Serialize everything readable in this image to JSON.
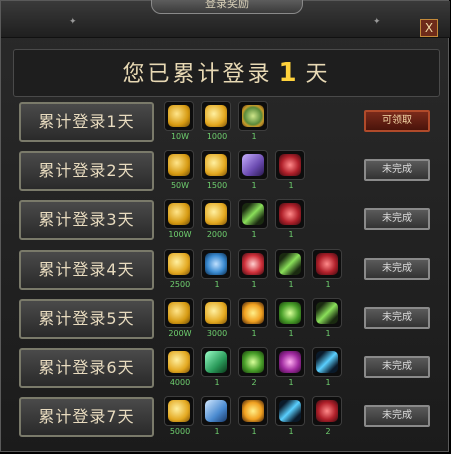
{
  "window": {
    "title": "登录奖励",
    "close_label": "X"
  },
  "header": {
    "prefix": "您已累计登录",
    "days": "1",
    "suffix": "天"
  },
  "rows": [
    {
      "label": "累计登录1天",
      "status": "可领取",
      "status_type": "claim",
      "items": [
        {
          "icon": "gold",
          "qty": "10W"
        },
        {
          "icon": "gold2",
          "qty": "1000"
        },
        {
          "icon": "egg",
          "qty": "1"
        }
      ]
    },
    {
      "label": "累计登录2天",
      "status": "未完成",
      "status_type": "todo",
      "items": [
        {
          "icon": "gold",
          "qty": "50W"
        },
        {
          "icon": "gold2",
          "qty": "1500"
        },
        {
          "icon": "wing",
          "qty": "1"
        },
        {
          "icon": "red",
          "qty": "1"
        }
      ]
    },
    {
      "label": "累计登录3天",
      "status": "未完成",
      "status_type": "todo",
      "items": [
        {
          "icon": "gold",
          "qty": "100W"
        },
        {
          "icon": "gold2",
          "qty": "2000"
        },
        {
          "icon": "green",
          "qty": "1"
        },
        {
          "icon": "red",
          "qty": "1"
        }
      ]
    },
    {
      "label": "累计登录4天",
      "status": "未完成",
      "status_type": "todo",
      "items": [
        {
          "icon": "gold2",
          "qty": "2500"
        },
        {
          "icon": "blue",
          "qty": "1"
        },
        {
          "icon": "redpot",
          "qty": "1"
        },
        {
          "icon": "green",
          "qty": "1"
        },
        {
          "icon": "red",
          "qty": "1"
        }
      ]
    },
    {
      "label": "累计登录5天",
      "status": "未完成",
      "status_type": "todo",
      "items": [
        {
          "icon": "gold",
          "qty": "200W"
        },
        {
          "icon": "gold2",
          "qty": "3000"
        },
        {
          "icon": "fire",
          "qty": "1"
        },
        {
          "icon": "orb",
          "qty": "1"
        },
        {
          "icon": "green",
          "qty": "1"
        }
      ]
    },
    {
      "label": "累计登录6天",
      "status": "未完成",
      "status_type": "todo",
      "items": [
        {
          "icon": "gold2",
          "qty": "4000"
        },
        {
          "icon": "ticket",
          "qty": "1"
        },
        {
          "icon": "orb",
          "qty": "2"
        },
        {
          "icon": "purple",
          "qty": "1"
        },
        {
          "icon": "cyan",
          "qty": "1"
        }
      ]
    },
    {
      "label": "累计登录7天",
      "status": "未完成",
      "status_type": "todo",
      "items": [
        {
          "icon": "gold2",
          "qty": "5000"
        },
        {
          "icon": "bluecard",
          "qty": "1"
        },
        {
          "icon": "fire",
          "qty": "1"
        },
        {
          "icon": "cyan",
          "qty": "1"
        },
        {
          "icon": "red",
          "qty": "2"
        }
      ]
    }
  ]
}
